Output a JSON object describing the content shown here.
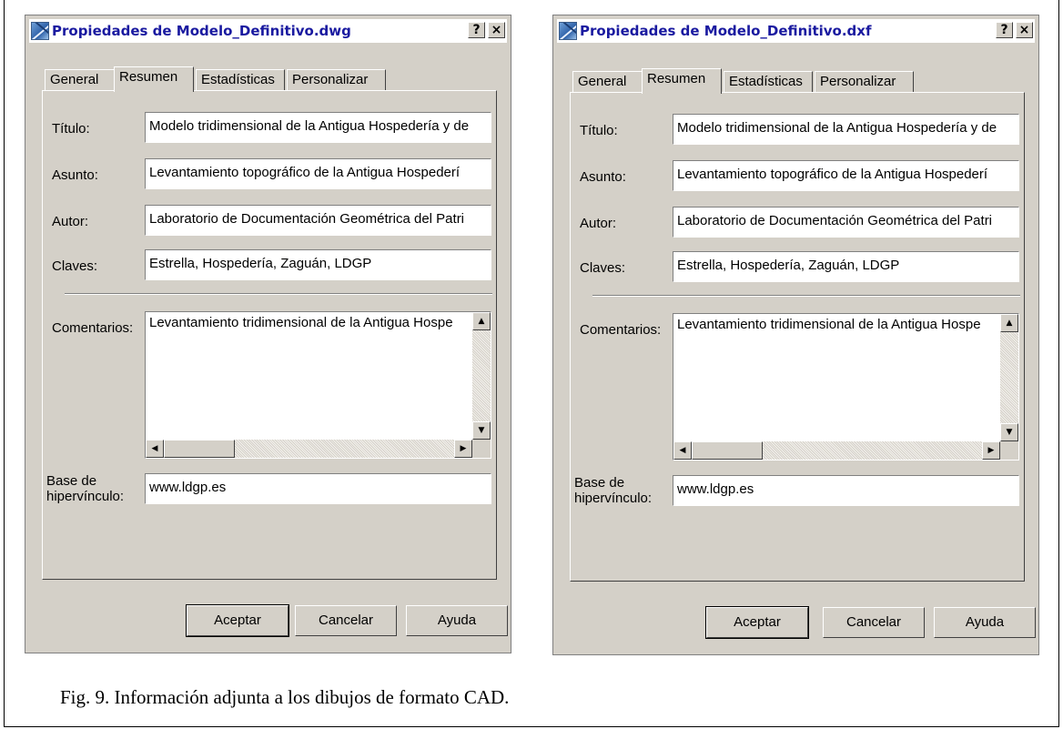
{
  "dialogs": [
    {
      "title": "Propiedades de Modelo_Definitivo.dwg",
      "help_button": "?",
      "close_button": "×",
      "tabs": [
        "General",
        "Resumen",
        "Estadísticas",
        "Personalizar"
      ],
      "active_tab": "Resumen",
      "fields": {
        "titulo_label": "Título:",
        "titulo_value": "Modelo tridimensional de la Antigua Hospedería y de",
        "asunto_label": "Asunto:",
        "asunto_value": "Levantamiento topográfico de la Antigua Hospederí",
        "autor_label": "Autor:",
        "autor_value": "Laboratorio de Documentación Geométrica del Patri",
        "claves_label": "Claves:",
        "claves_value": "Estrella, Hospedería, Zaguán, LDGP",
        "comentarios_label": "Comentarios:",
        "comentarios_value": "Levantamiento tridimensional de la Antigua Hospe",
        "base_label_1": "Base de",
        "base_label_2": "hipervínculo:",
        "base_value": "www.ldgp.es"
      },
      "buttons": {
        "ok": "Aceptar",
        "cancel": "Cancelar",
        "help": "Ayuda"
      }
    },
    {
      "title": "Propiedades de Modelo_Definitivo.dxf",
      "help_button": "?",
      "close_button": "×",
      "tabs": [
        "General",
        "Resumen",
        "Estadísticas",
        "Personalizar"
      ],
      "active_tab": "Resumen",
      "fields": {
        "titulo_label": "Título:",
        "titulo_value": "Modelo tridimensional de la Antigua Hospedería y de",
        "asunto_label": "Asunto:",
        "asunto_value": "Levantamiento topográfico de la Antigua Hospederí",
        "autor_label": "Autor:",
        "autor_value": "Laboratorio de Documentación Geométrica del Patri",
        "claves_label": "Claves:",
        "claves_value": "Estrella, Hospedería, Zaguán, LDGP",
        "comentarios_label": "Comentarios:",
        "comentarios_value": "Levantamiento tridimensional de la Antigua Hospe",
        "base_label_1": "Base de",
        "base_label_2": "hipervínculo:",
        "base_value": "www.ldgp.es"
      },
      "buttons": {
        "ok": "Aceptar",
        "cancel": "Cancelar",
        "help": "Ayuda"
      }
    }
  ],
  "caption": "Fig. 9. Información adjunta a los dibujos de formato CAD.",
  "colors": {
    "dialog_bg": "#d4d0c8",
    "title_text": "#1a1aa0",
    "field_bg": "#ffffff"
  },
  "icons": {
    "app": "autocad-app-icon",
    "scroll_up": "▲",
    "scroll_down": "▼",
    "scroll_left": "◀",
    "scroll_right": "▶"
  }
}
